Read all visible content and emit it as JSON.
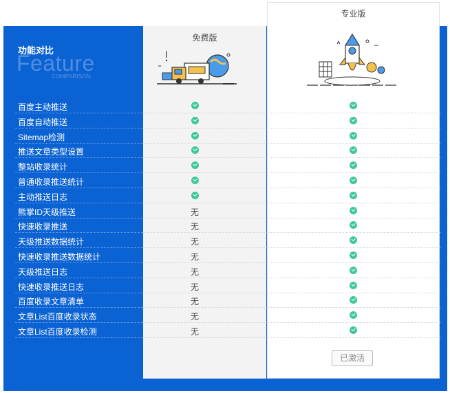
{
  "header": {
    "title": "功能对比",
    "feature_word": "Feature",
    "comparison_word": "COMPARISON"
  },
  "plans": {
    "free": {
      "name": "免费版"
    },
    "pro": {
      "name": "专业版",
      "button_label": "已激活"
    }
  },
  "features": [
    {
      "label": "百度主动推送",
      "free": "check",
      "pro": "check"
    },
    {
      "label": "百度自动推送",
      "free": "check",
      "pro": "check"
    },
    {
      "label": "Sitemap检测",
      "free": "check",
      "pro": "check"
    },
    {
      "label": "推送文章类型设置",
      "free": "check",
      "pro": "check"
    },
    {
      "label": "整站收录统计",
      "free": "check",
      "pro": "check"
    },
    {
      "label": "普通收录推送统计",
      "free": "check",
      "pro": "check"
    },
    {
      "label": "主动推送日志",
      "free": "check",
      "pro": "check"
    },
    {
      "label": "熊掌ID天级推送",
      "free": "无",
      "pro": "check"
    },
    {
      "label": "快速收录推送",
      "free": "无",
      "pro": "check"
    },
    {
      "label": "天级推送数据统计",
      "free": "无",
      "pro": "check"
    },
    {
      "label": "快速收录推送数据统计",
      "free": "无",
      "pro": "check"
    },
    {
      "label": "天级推送日志",
      "free": "无",
      "pro": "check"
    },
    {
      "label": "快速收录推送日志",
      "free": "无",
      "pro": "check"
    },
    {
      "label": "百度收录文章清单",
      "free": "无",
      "pro": "check"
    },
    {
      "label": "文章List百度收录状态",
      "free": "无",
      "pro": "check"
    },
    {
      "label": "文章List百度收录检测",
      "free": "无",
      "pro": "check"
    }
  ],
  "colors": {
    "panel_blue": "#0b62d3",
    "check_green": "#3fc79a",
    "free_bg": "#f3f3f3"
  },
  "icons": {
    "included": "check-circle-icon"
  }
}
